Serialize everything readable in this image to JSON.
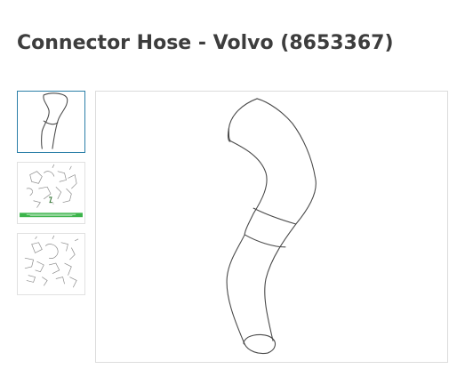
{
  "product": {
    "title": "Connector Hose - Volvo (8653367)"
  },
  "gallery": {
    "selected_index": 0,
    "thumbnails": [
      {
        "alt": "connector-hose-photo",
        "selected": true
      },
      {
        "alt": "exploded-diagram-with-highlight",
        "selected": false
      },
      {
        "alt": "exploded-diagram",
        "selected": false
      }
    ]
  },
  "colors": {
    "title": "#3d3d3d",
    "selected_border": "#2b7fa8",
    "thumb_border": "#e1e1e1",
    "highlight_band": "#3cb44b"
  }
}
